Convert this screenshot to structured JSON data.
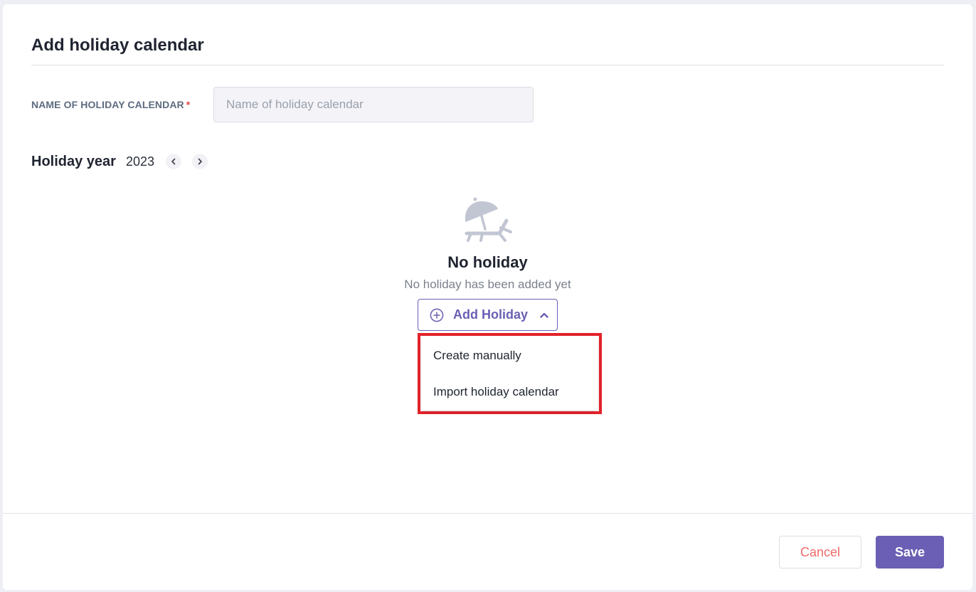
{
  "modal": {
    "title": "Add holiday calendar"
  },
  "name_field": {
    "label": "NAME OF HOLIDAY CALENDAR",
    "required_mark": "*",
    "placeholder": "Name of holiday calendar",
    "value": ""
  },
  "holiday_year": {
    "label": "Holiday year",
    "value": "2023",
    "prev_icon": "chevron-left-icon",
    "next_icon": "chevron-right-icon"
  },
  "empty_state": {
    "icon": "beach-umbrella-icon",
    "title": "No holiday",
    "subtitle": "No holiday has been added yet"
  },
  "add_holiday": {
    "label": "Add Holiday",
    "icon": "plus-circle-icon",
    "toggle_icon": "chevron-up-icon",
    "menu": [
      {
        "label": "Create manually"
      },
      {
        "label": "Import holiday calendar"
      }
    ]
  },
  "footer": {
    "cancel_label": "Cancel",
    "save_label": "Save"
  },
  "colors": {
    "accent": "#6a5fb4",
    "cancel_text": "#ef6b6b",
    "highlight": "#e3222a",
    "icon_gray": "#c2c6d3"
  }
}
